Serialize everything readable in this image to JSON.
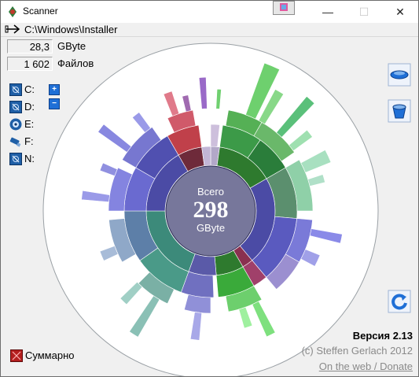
{
  "window": {
    "title": "Scanner",
    "controls": {
      "minimize": "—",
      "maximize": "☐",
      "close": "✕"
    }
  },
  "path": "C:\\Windows\\Installer",
  "stats": {
    "size_value": "28,3",
    "size_unit": "GByte",
    "files_value": "1 602",
    "files_label": "Файлов"
  },
  "drives": [
    {
      "label": "C:",
      "icon": "hard-drive-icon"
    },
    {
      "label": "D:",
      "icon": "hard-drive-icon"
    },
    {
      "label": "E:",
      "icon": "optical-disc-icon"
    },
    {
      "label": "F:",
      "icon": "usb-drive-icon"
    },
    {
      "label": "N:",
      "icon": "network-drive-icon"
    }
  ],
  "zoom": {
    "in": "+",
    "out": "−"
  },
  "center": {
    "label_top": "Всего",
    "value": "298",
    "unit": "GByte"
  },
  "footer": {
    "version": "Версия 2.13",
    "copyright": "(c) Steffen Gerlach 2012",
    "link": "On the web / Donate"
  },
  "summary": {
    "label": "Суммарно",
    "icon": "summary-icon"
  },
  "colors": {
    "center_fill": "#77779b",
    "ring_blue": "#4b4ba5",
    "ring_green": "#2c8a2c",
    "ring_red": "#a8384a",
    "ring_teal": "#4f8f86",
    "outline": "#9aa0a5"
  }
}
